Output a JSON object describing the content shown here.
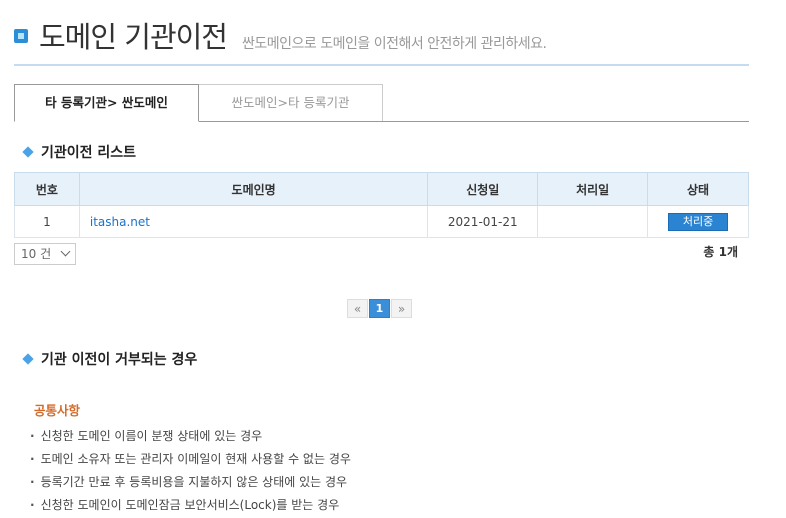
{
  "header": {
    "title": "도메인 기관이전",
    "subtitle": "싼도메인으로 도메인을 이전해서 안전하게 관리하세요."
  },
  "tabs": [
    {
      "label": "타 등록기관> 싼도메인"
    },
    {
      "label": "싼도메인>타 등록기관"
    }
  ],
  "list_section": {
    "title": "기관이전 리스트"
  },
  "table": {
    "columns": [
      "번호",
      "도메인명",
      "신청일",
      "처리일",
      "상태"
    ],
    "rows": [
      {
        "no": "1",
        "domain": "itasha.net",
        "applied": "2021-01-21",
        "processed": "",
        "status": "처리중"
      }
    ]
  },
  "per_page": {
    "value": "10 건"
  },
  "total": "총 1개",
  "pagination": {
    "prev": "«",
    "current": "1",
    "next": "»"
  },
  "reject_section": {
    "title": "기관 이전이 거부되는 경우"
  },
  "notice": {
    "heading": "공통사항",
    "items": [
      "신청한 도메인 이름이 분쟁 상태에 있는 경우",
      "도메인 소유자 또는 관리자 이메일이 현재 사용할 수 없는 경우",
      "등록기간 만료 후 등록비용을 지불하지 않은 상태에 있는 경우",
      "신청한 도메인이 도메인잠금 보안서비스(Lock)를 받는 경우"
    ]
  },
  "colors": {
    "accent": "#2a84d2",
    "notice_heading": "#d46b2a",
    "table_header_bg": "#e7f1fa"
  }
}
